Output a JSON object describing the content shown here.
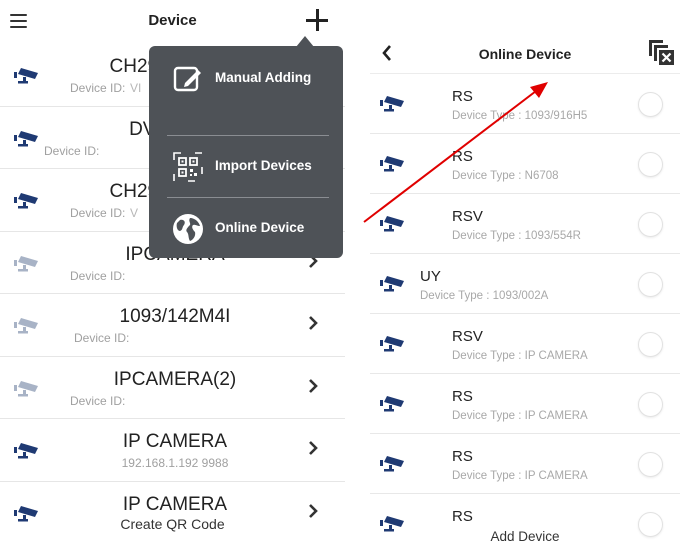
{
  "left_screen": {
    "header": {
      "title": "Device",
      "menu_icon": "menu-icon",
      "add_icon": "plus-icon"
    },
    "devices": [
      {
        "name": "CH292H3_16M",
        "sub": "Device ID:",
        "sub_extra": "VI",
        "enabled": true
      },
      {
        "name": "DVR-04D1",
        "sub": "Device ID:",
        "sub_extra": "",
        "enabled": true
      },
      {
        "name": "CH292H3_16M",
        "sub": "Device ID:",
        "sub_extra": "V",
        "enabled": true
      },
      {
        "name": "IPCAMERA",
        "sub": "Device ID:",
        "sub_extra": "",
        "enabled": false
      },
      {
        "name": "1093/142M4I",
        "sub": "Device ID:",
        "sub_extra": "",
        "enabled": false
      },
      {
        "name": "IPCAMERA(2)",
        "sub": "Device ID:",
        "sub_extra": "",
        "enabled": false
      },
      {
        "name": "IP CAMERA",
        "sub": "192.168.1.192   9988",
        "sub_extra": "",
        "enabled": true
      },
      {
        "name": "IP CAMERA",
        "sub": "",
        "sub_extra": "",
        "enabled": true
      }
    ],
    "popup_menu": [
      {
        "label": "Manual Adding",
        "icon": "edit-icon"
      },
      {
        "label": "Import Devices",
        "icon": "qr-code-icon"
      },
      {
        "label": "Online Device",
        "icon": "globe-icon"
      }
    ],
    "footer": "Create QR Code"
  },
  "right_screen": {
    "header": {
      "title": "Online Device",
      "back_icon": "back-arrow-icon",
      "action_icon": "close-copy-icon"
    },
    "devices": [
      {
        "name": "RS",
        "type": "Device Type : 1093/916H5"
      },
      {
        "name": "RS",
        "type": "Device Type : N6708"
      },
      {
        "name": "RSV",
        "type": "Device Type : 1093/554R"
      },
      {
        "name": "UY",
        "type": "Device Type : 1093/002A"
      },
      {
        "name": "RSV",
        "type": "Device Type : IP CAMERA"
      },
      {
        "name": "RS",
        "type": "Device Type : IP CAMERA"
      },
      {
        "name": "RS",
        "type": "Device Type : IP CAMERA"
      },
      {
        "name": "RS",
        "type": ""
      }
    ],
    "footer": "Add Device"
  },
  "colors": {
    "camera_active": "#1f3a73",
    "camera_disabled": "#a8b3c6",
    "popup_bg": "#4e5257",
    "annotation_arrow": "#e00000"
  }
}
